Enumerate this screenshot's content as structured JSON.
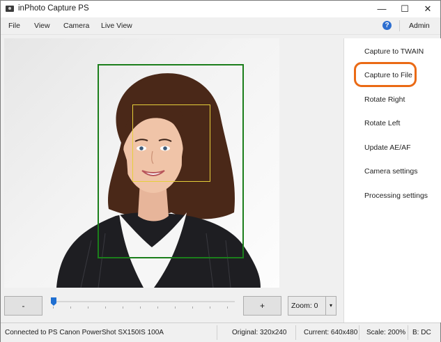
{
  "window": {
    "title": "inPhoto Capture PS",
    "controls": {
      "minimize": "—",
      "maximize": "☐",
      "close": "✕"
    }
  },
  "menu": {
    "items": [
      "File",
      "View",
      "Camera",
      "Live View"
    ],
    "help_icon": "help-icon",
    "help_glyph": "?",
    "admin_label": "Admin"
  },
  "side_panel": {
    "items": [
      "Capture to TWAIN",
      "Capture to File",
      "Rotate Right",
      "Rotate Left",
      "Update AE/AF",
      "Camera settings",
      "Processing settings"
    ],
    "highlight_color": "#ea6a15"
  },
  "controls": {
    "zoom_out_label": "-",
    "zoom_in_label": "+",
    "zoom_value": "Zoom: 0",
    "zoom_arrow": "▾",
    "slider_level": 0
  },
  "status": {
    "connection": "Connected to PS Canon PowerShot SX150IS 100A",
    "original": "Original: 320x240",
    "current": "Current: 640x480",
    "scale": "Scale: 200%",
    "extra": "B: DC"
  },
  "colors": {
    "accent": "#1f6fd1",
    "face_frame": "#1b7e1b",
    "eye_frame": "#e6cf3a"
  }
}
